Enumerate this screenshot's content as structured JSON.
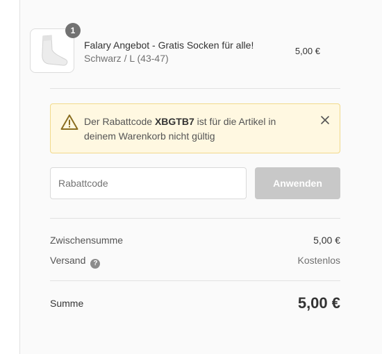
{
  "product": {
    "quantity": "1",
    "name": "Falary Angebot - Gratis Socken für alle!",
    "variant": "Schwarz / L (43-47)",
    "price": "5,00 €",
    "image_icon": "sock-icon"
  },
  "banner": {
    "prefix": "Der Rabattcode ",
    "code": "XBGTB7",
    "suffix": " ist für die Artikel in deinem Warenkorb nicht gültig",
    "background": "#fff8e1",
    "border": "#f1d98a"
  },
  "discount": {
    "placeholder": "Rabattcode",
    "apply_label": "Anwenden"
  },
  "totals": {
    "subtotal_label": "Zwischensumme",
    "subtotal_value": "5,00 €",
    "shipping_label": "Versand",
    "shipping_value": "Kostenlos",
    "total_label": "Summe",
    "total_value": "5,00 €"
  }
}
